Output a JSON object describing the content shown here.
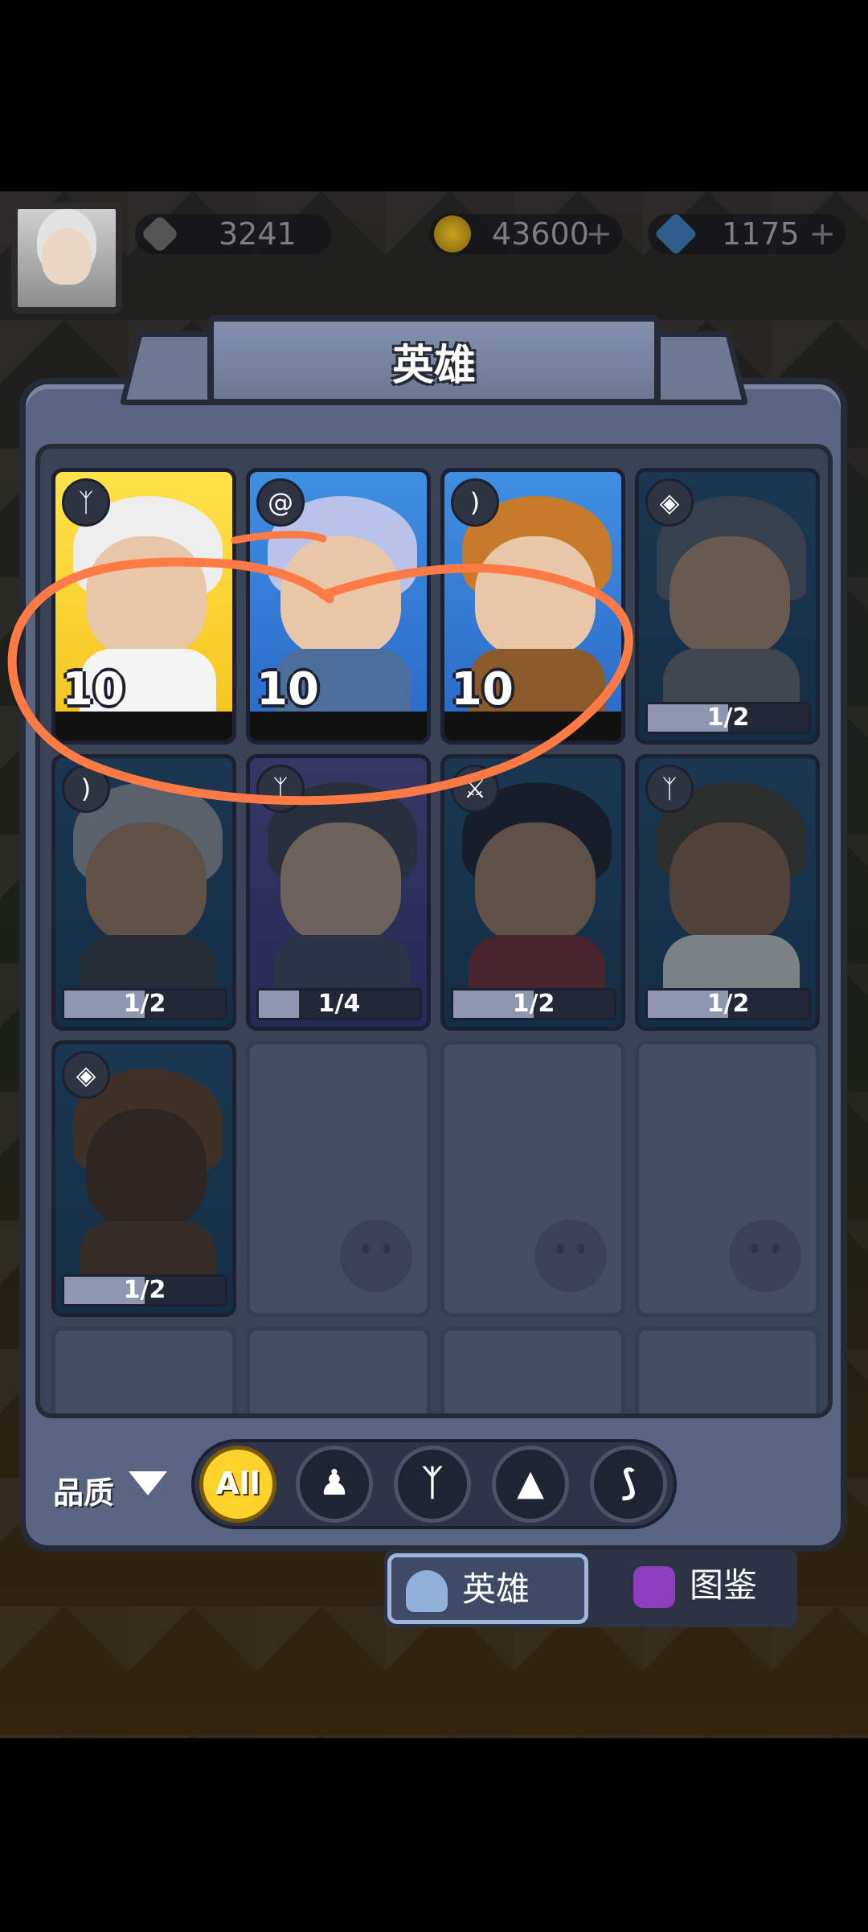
{
  "topbar": {
    "power": "3241",
    "gold": "43600",
    "gems": "1175",
    "plus": "+"
  },
  "panel": {
    "title": "英雄"
  },
  "heroes": [
    {
      "name": "hero-white-hair",
      "level": "10",
      "class_icon": "feather-icon"
    },
    {
      "name": "hero-silver-hair",
      "level": "10",
      "class_icon": "swirl-icon"
    },
    {
      "name": "hero-fox-ears",
      "level": "10",
      "class_icon": "bow-icon"
    },
    {
      "name": "hero-helmet-soldier",
      "shards": "1/2",
      "shards_fill": 0.5,
      "class_icon": "shield-icon"
    },
    {
      "name": "hero-gray-hair",
      "shards": "1/2",
      "shards_fill": 0.5,
      "class_icon": "bow-icon"
    },
    {
      "name": "hero-dark-hair",
      "shards": "1/4",
      "shards_fill": 0.25,
      "class_icon": "feather-icon"
    },
    {
      "name": "hero-black-hair",
      "shards": "1/2",
      "shards_fill": 0.5,
      "class_icon": "sword-icon"
    },
    {
      "name": "hero-fur-hat",
      "shards": "1/2",
      "shards_fill": 0.5,
      "class_icon": "feather-icon"
    },
    {
      "name": "hero-knight",
      "shards": "1/2",
      "shards_fill": 0.5,
      "class_icon": "shield-icon"
    }
  ],
  "filter": {
    "label": "品质",
    "all_label": "All",
    "options": [
      "pawn-icon",
      "wings-icon",
      "hood-icon",
      "claw-icon"
    ]
  },
  "tabs": {
    "heroes": "英雄",
    "codex": "图鉴"
  },
  "colors": {
    "annotation": "#ff7a45",
    "active_filter": "#ffd22a",
    "rare_card": "#3f8fe2",
    "legend_card": "#ffe24a"
  }
}
